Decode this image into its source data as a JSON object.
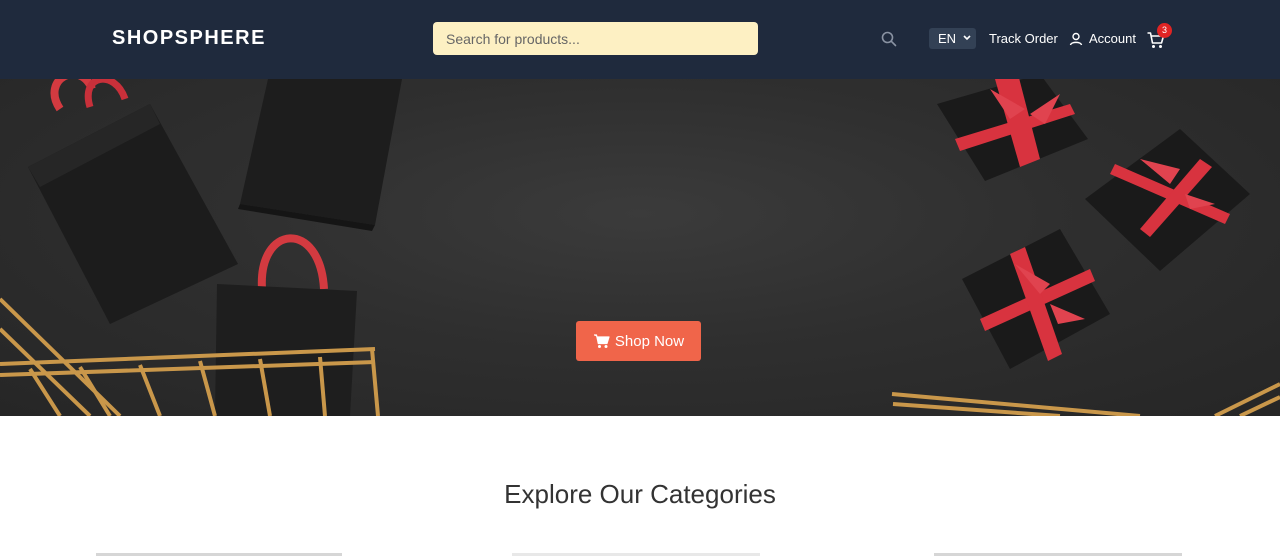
{
  "header": {
    "logo": "SHOPSPHERE",
    "search_placeholder": "Search for products...",
    "language": "EN",
    "track_order": "Track Order",
    "account": "Account",
    "cart_count": "3"
  },
  "hero": {
    "button_label": "Shop Now"
  },
  "categories": {
    "title": "Explore Our Categories"
  },
  "icons": [
    "search-icon",
    "chevron-down-icon",
    "user-icon",
    "cart-icon"
  ],
  "colors": {
    "header_bg": "#1f2a3d",
    "search_bg": "#fdf0c3",
    "cta": "#f0654a",
    "badge": "#e02424",
    "ribbon": "#d8333f",
    "gold": "#c9974a"
  }
}
